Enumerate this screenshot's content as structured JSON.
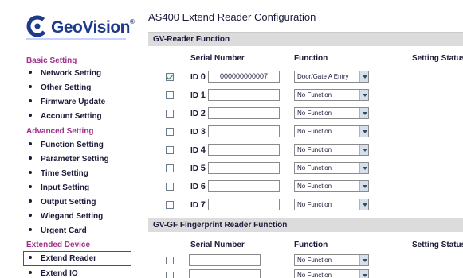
{
  "brand": {
    "name": "GeoVision",
    "reg": "®"
  },
  "sidebar": {
    "sections": [
      {
        "title": "Basic Setting",
        "items": [
          "Network Setting",
          "Other Setting",
          "Firmware Update",
          "Account Setting"
        ]
      },
      {
        "title": "Advanced Setting",
        "items": [
          "Function Setting",
          "Parameter Setting",
          "Time Setting",
          "Input Setting",
          "Output Setting",
          "Wiegand Setting",
          "Urgent Card"
        ]
      },
      {
        "title": "Extended Device",
        "items": [
          "Extend Reader",
          "Extend IO"
        ]
      }
    ],
    "active_item": "Extend Reader"
  },
  "main": {
    "title": "AS400 Extend Reader Configuration",
    "gv_reader": {
      "section_title": "GV-Reader Function",
      "headers": {
        "serial": "Serial Number",
        "function": "Function",
        "status": "Setting Status"
      },
      "rows": [
        {
          "id_prefix": "ID ",
          "id_num": "0",
          "checked": true,
          "serial": "000000000007",
          "function": "Door/Gate A Entry"
        },
        {
          "id_prefix": "ID ",
          "id_num": "1",
          "checked": false,
          "serial": "",
          "function": "No Function"
        },
        {
          "id_prefix": "ID ",
          "id_num": "2",
          "checked": false,
          "serial": "",
          "function": "No Function"
        },
        {
          "id_prefix": "ID ",
          "id_num": "3",
          "checked": false,
          "serial": "",
          "function": "No Function"
        },
        {
          "id_prefix": "ID ",
          "id_num": "4",
          "checked": false,
          "serial": "",
          "function": "No Function"
        },
        {
          "id_prefix": "ID ",
          "id_num": "5",
          "checked": false,
          "serial": "",
          "function": "No Function"
        },
        {
          "id_prefix": "ID ",
          "id_num": "6",
          "checked": false,
          "serial": "",
          "function": "No Function"
        },
        {
          "id_prefix": "ID ",
          "id_num": "7",
          "checked": false,
          "serial": "",
          "function": "No Function"
        }
      ]
    },
    "gv_gf": {
      "section_title": "GV-GF Fingerprint Reader Function",
      "headers": {
        "serial": "Serial Number",
        "function": "Function",
        "status": "Setting Status"
      },
      "rows": [
        {
          "checked": false,
          "serial": "",
          "function": "No Function"
        },
        {
          "checked": false,
          "serial": "",
          "function": "No Function"
        }
      ]
    }
  }
}
